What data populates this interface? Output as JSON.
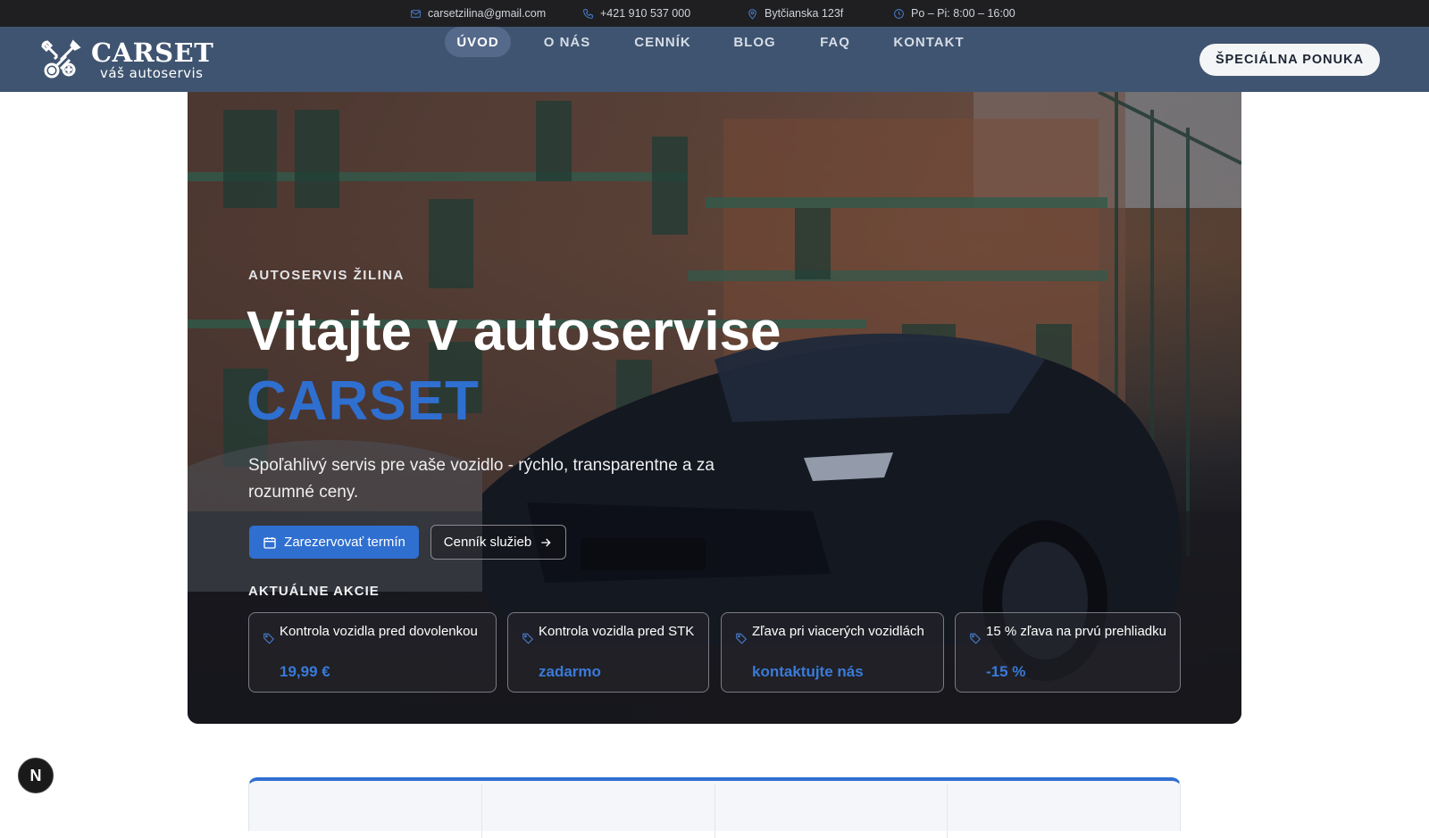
{
  "topbar": {
    "email": "carsetzilina@gmail.com",
    "phone": "+421 910 537 000",
    "address": "Bytčianska 123f",
    "hours": "Po – Pi: 8:00 – 16:00"
  },
  "logo": {
    "name": "CARSET",
    "tagline": "váš autoservis"
  },
  "nav": {
    "items": [
      "ÚVOD",
      "O NÁS",
      "CENNÍK",
      "BLOG",
      "FAQ",
      "KONTAKT"
    ],
    "active": "ÚVOD",
    "cta": "ŠPECIÁLNA PONUKA"
  },
  "hero": {
    "eyebrow": "AUTOSERVIS ŽILINA",
    "title_line1": "Vitajte v autoservise",
    "title_line2": "CARSET",
    "lead": "Spoľahlivý servis pre vaše vozidlo - rýchlo, transparentne a za rozumné ceny.",
    "btn_primary": "Zarezervovať termín",
    "btn_secondary": "Cenník služieb",
    "promo_heading": "AKTUÁLNE AKCIE",
    "promos": [
      {
        "title": "Kontrola vozidla pred dovolenkou",
        "price": "19,99 €"
      },
      {
        "title": "Kontrola vozidla pred STK",
        "price": "zadarmo"
      },
      {
        "title": "Zľava pri viacerých vozidlách",
        "price": "kontaktujte nás"
      },
      {
        "title": "15 % zľava na prvú prehliadku",
        "price": "-15 %"
      }
    ]
  },
  "badge": {
    "letter": "N"
  },
  "colors": {
    "accent": "#2f6fd0",
    "navbar": "#3f5470",
    "topbar": "#1f1f22"
  }
}
